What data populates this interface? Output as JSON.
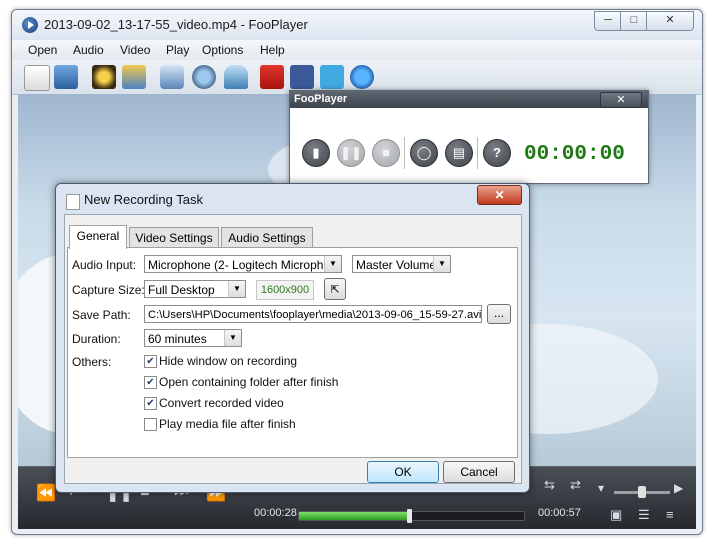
{
  "window": {
    "title": "2013-09-02_13-17-55_video.mp4 - FooPlayer",
    "minimize_icon": "minimize-icon",
    "maximize_icon": "maximize-icon",
    "close_icon": "close-icon"
  },
  "menu": {
    "items": [
      "Open",
      "Audio",
      "Video",
      "Play",
      "Options",
      "Help"
    ]
  },
  "toolbar": {
    "icons": [
      "document-icon",
      "monitor-icon",
      "gallery-icon",
      "picture-icon",
      "screen-capture-icon",
      "webcam-icon",
      "microphone-icon",
      "youtube-icon",
      "facebook-icon",
      "twitter-icon",
      "globe-icon"
    ]
  },
  "mini_recorder": {
    "title": "FooPlayer",
    "close": "✕",
    "timer": "00:00:00",
    "buttons": [
      "new-task-icon",
      "pause-icon",
      "stop-icon",
      "comment-icon",
      "folder-icon",
      "help-icon"
    ]
  },
  "dialog": {
    "title": "New Recording Task",
    "close": "✕",
    "tabs": [
      "General",
      "Video Settings",
      "Audio Settings"
    ],
    "active_tab": "General",
    "audio_input": {
      "label": "Audio Input:",
      "device": "Microphone (2- Logitech Microph",
      "volume": "Master Volume"
    },
    "capture_size": {
      "label": "Capture Size:",
      "value": "Full Desktop",
      "resolution": "1600x900"
    },
    "save_path": {
      "label": "Save Path:",
      "value": "C:\\Users\\HP\\Documents\\fooplayer\\media\\2013-09-06_15-59-27.avi",
      "browse": "..."
    },
    "duration": {
      "label": "Duration:",
      "value": "60 minutes"
    },
    "others": {
      "label": "Others:",
      "options": [
        {
          "label": "Hide window on recording",
          "checked": true
        },
        {
          "label": "Open containing folder after finish",
          "checked": true
        },
        {
          "label": "Convert recorded video",
          "checked": true
        },
        {
          "label": "Play media file after finish",
          "checked": false
        }
      ]
    },
    "ok": "OK",
    "cancel": "Cancel"
  },
  "player": {
    "time_current": "00:00:28",
    "time_total": "00:00:57",
    "progress": 0.49,
    "volume": 0.5,
    "controls": [
      "rewind-icon",
      "previous-icon",
      "pause-icon",
      "stop-icon",
      "next-icon",
      "fast-forward-icon"
    ]
  }
}
